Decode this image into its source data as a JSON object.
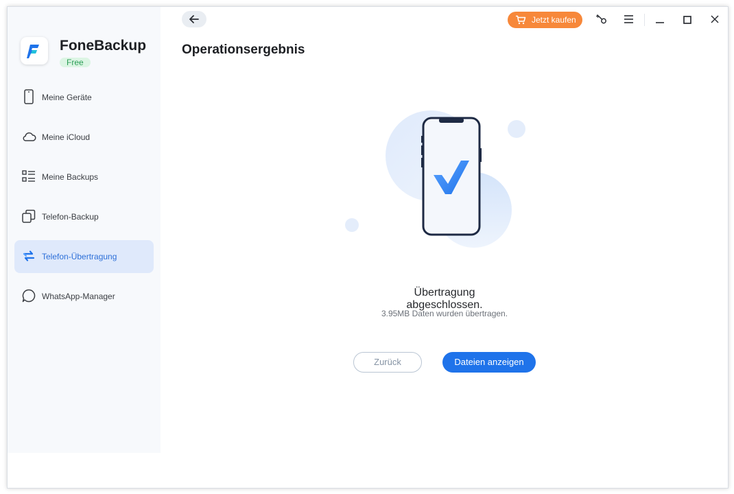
{
  "app": {
    "name": "FoneBackup",
    "badge": "Free"
  },
  "sidebar": {
    "items": [
      {
        "label": "Meine Geräte",
        "icon": "phone-icon",
        "active": false
      },
      {
        "label": "Meine iCloud",
        "icon": "cloud-icon",
        "active": false
      },
      {
        "label": "Meine Backups",
        "icon": "list-icon",
        "active": false
      },
      {
        "label": "Telefon-Backup",
        "icon": "copy-icon",
        "active": false
      },
      {
        "label": "Telefon-Übertragung",
        "icon": "transfer-arrows-icon",
        "active": true
      },
      {
        "label": "WhatsApp-Manager",
        "icon": "chat-bubble-icon",
        "active": false
      }
    ]
  },
  "toolbar": {
    "buy_label": "Jetzt kaufen",
    "icons": [
      "back-arrow-icon",
      "cart-icon",
      "key-icon",
      "menu-icon",
      "minimize-icon",
      "maximize-icon",
      "close-icon"
    ]
  },
  "main": {
    "title": "Operationsergebnis",
    "result_title": "Übertragung abgeschlossen.",
    "result_subtitle": "3.95MB Daten wurden übertragen.",
    "back_button": "Zurück",
    "files_button": "Dateien anzeigen"
  },
  "colors": {
    "accent": "#1f73ea",
    "buy": "#f7883a",
    "active_bg": "#dfe9fb",
    "badge_bg": "#dcf5e4",
    "badge_text": "#2a9d55"
  }
}
